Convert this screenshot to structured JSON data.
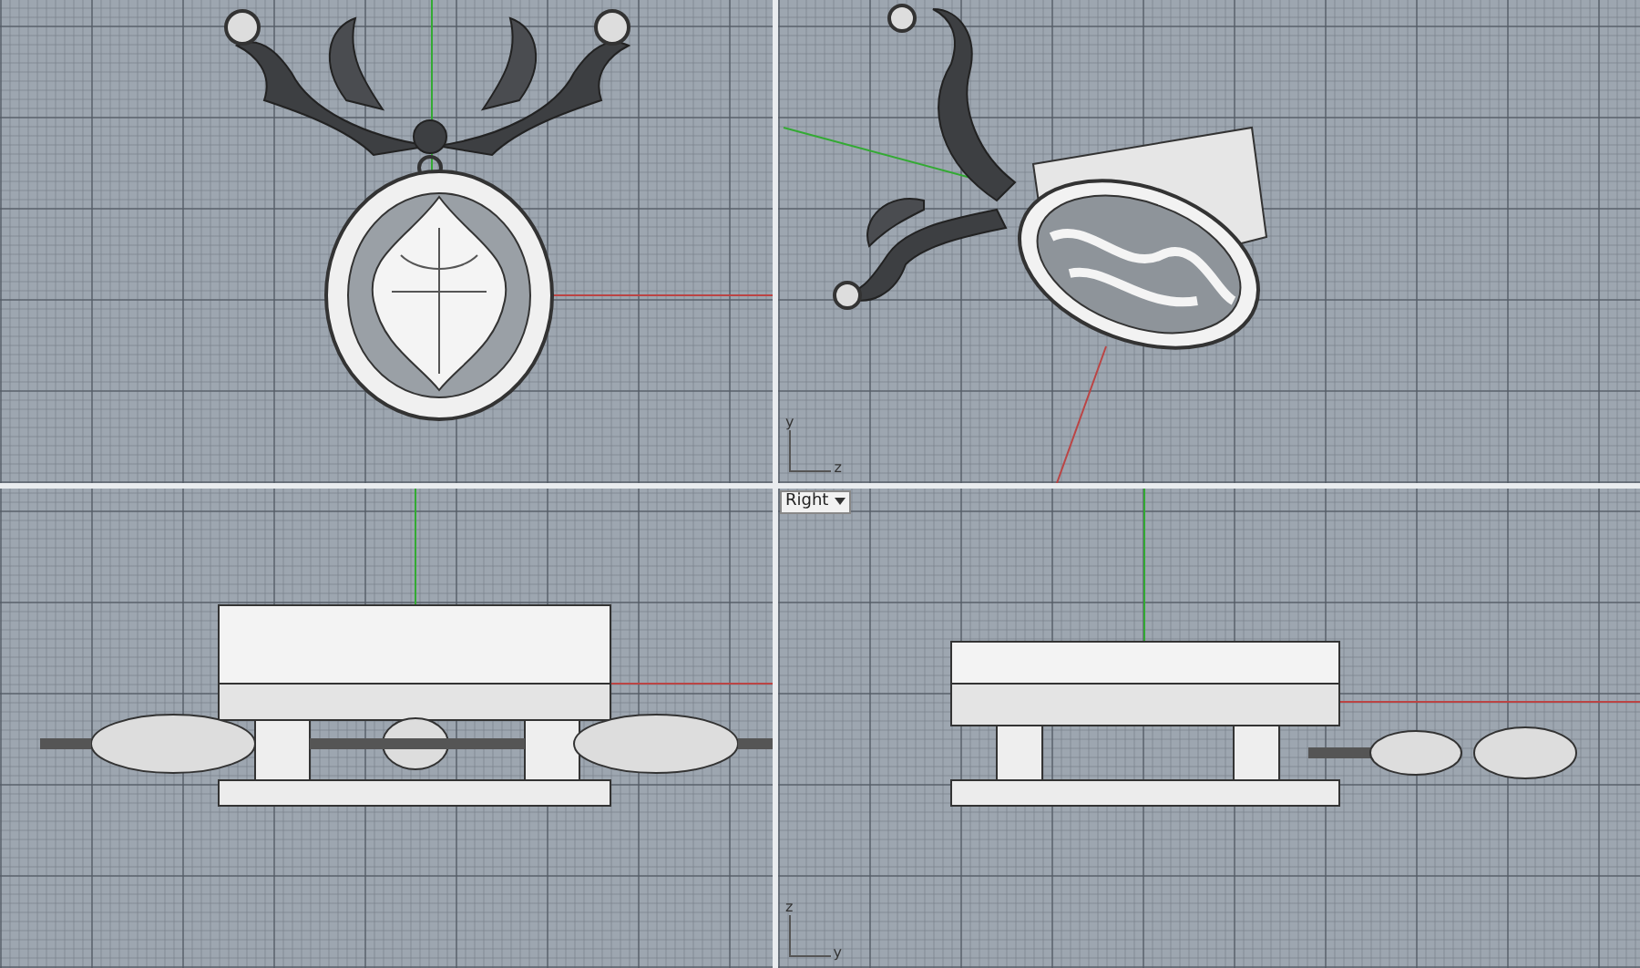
{
  "viewports": [
    {
      "kind": "front"
    },
    {
      "kind": "perspective",
      "axes": [
        "y",
        "z"
      ]
    },
    {
      "kind": "top"
    },
    {
      "kind": "right",
      "label": "Right",
      "axes": [
        "z",
        "y"
      ]
    }
  ]
}
